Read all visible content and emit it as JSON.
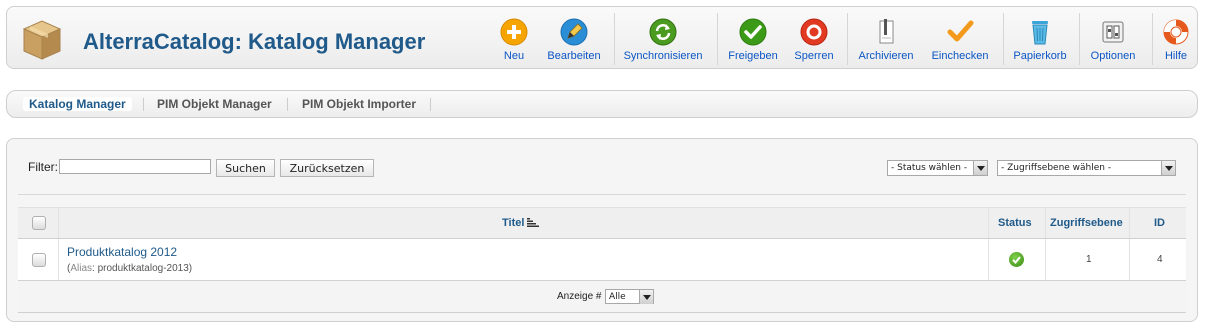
{
  "header": {
    "title": "AlterraCatalog: Katalog Manager",
    "buttons": [
      {
        "label": "Neu",
        "icon": "plus-icon",
        "color": "#f6a500"
      },
      {
        "label": "Bearbeiten",
        "icon": "pencil-icon",
        "color": "#2a8ed6"
      },
      {
        "label": "Synchronisieren",
        "icon": "sync-icon",
        "color": "#4a9b1f"
      },
      {
        "label": "Freigeben",
        "icon": "checkmark-icon",
        "color": "#3b9b17"
      },
      {
        "label": "Sperren",
        "icon": "block-icon",
        "color": "#e23a22"
      },
      {
        "label": "Archivieren",
        "icon": "archive-icon",
        "color": "#888888"
      },
      {
        "label": "Einchecken",
        "icon": "checkin-icon",
        "color": "#f39a1d"
      },
      {
        "label": "Papierkorb",
        "icon": "trash-icon",
        "color": "#3aa4d8"
      },
      {
        "label": "Optionen",
        "icon": "options-icon",
        "color": "#777777"
      },
      {
        "label": "Hilfe",
        "icon": "help-icon",
        "color": "#e55a1c"
      }
    ]
  },
  "submenu": {
    "items": [
      {
        "label": "Katalog Manager",
        "active": true
      },
      {
        "label": "PIM Objekt Manager",
        "active": false
      },
      {
        "label": "PIM Objekt Importer",
        "active": false
      }
    ]
  },
  "filter": {
    "label": "Filter:",
    "value": "",
    "search_button": "Suchen",
    "reset_button": "Zurücksetzen",
    "status_select": "- Status wählen -",
    "access_select": "- Zugriffsebene wählen -"
  },
  "table": {
    "headers": {
      "title": "Titel",
      "status": "Status",
      "access": "Zugriffsebene",
      "id": "ID"
    },
    "rows": [
      {
        "title": "Produktkatalog 2012",
        "alias_label": "Alias",
        "alias_value": ": produktkatalog-2013)",
        "alias_open": "(",
        "status": "published",
        "access": "1",
        "id": "4"
      }
    ],
    "footer": {
      "display_label": "Anzeige #",
      "display_value": "Alle"
    }
  },
  "colors": {
    "accent": "#1f5a8a",
    "link": "#0b55c4",
    "published": "#3a8a14"
  }
}
